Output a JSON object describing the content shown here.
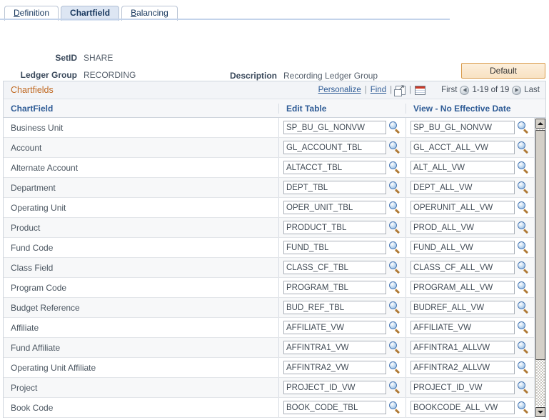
{
  "tabs": [
    {
      "label": "Definition",
      "accel": "D",
      "active": false,
      "name": "tab-definition"
    },
    {
      "label": "Chartfield",
      "accel": "",
      "active": true,
      "name": "tab-chartfield"
    },
    {
      "label": "Balancing",
      "accel": "B",
      "active": false,
      "name": "tab-balancing"
    }
  ],
  "header": {
    "setid_label": "SetID",
    "setid_value": "SHARE",
    "ledger_group_label": "Ledger Group",
    "ledger_group_value": "RECORDING",
    "description_label": "Description",
    "description_value": "Recording Ledger Group",
    "default_button": "Default"
  },
  "grid": {
    "title": "Chartfields",
    "personalize_link": "Personalize",
    "find_link": "Find",
    "sep1": "|",
    "sep2": "|",
    "sep3": "|",
    "expand_icon": "expand-window-icon",
    "spreadsheet_icon": "download-spreadsheet-icon",
    "first_label": "First",
    "last_label": "Last",
    "range_label": "1-19 of 19",
    "prev_icon": "previous-page-arrow-icon",
    "next_icon": "next-page-arrow-icon",
    "columns": {
      "chartfield": "ChartField",
      "edit_table": "Edit Table",
      "view_no_effective_date": "View - No Effective Date"
    },
    "lookup_icon": "lookup-magnifier-icon",
    "rows": [
      {
        "chartfield": "Business Unit",
        "edit_table": "SP_BU_GL_NONVW",
        "view": "SP_BU_GL_NONVW"
      },
      {
        "chartfield": "Account",
        "edit_table": "GL_ACCOUNT_TBL",
        "view": "GL_ACCT_ALL_VW"
      },
      {
        "chartfield": "Alternate Account",
        "edit_table": "ALTACCT_TBL",
        "view": "ALT_ALL_VW"
      },
      {
        "chartfield": "Department",
        "edit_table": "DEPT_TBL",
        "view": "DEPT_ALL_VW"
      },
      {
        "chartfield": "Operating Unit",
        "edit_table": "OPER_UNIT_TBL",
        "view": "OPERUNIT_ALL_VW"
      },
      {
        "chartfield": "Product",
        "edit_table": "PRODUCT_TBL",
        "view": "PROD_ALL_VW"
      },
      {
        "chartfield": "Fund Code",
        "edit_table": "FUND_TBL",
        "view": "FUND_ALL_VW"
      },
      {
        "chartfield": "Class Field",
        "edit_table": "CLASS_CF_TBL",
        "view": "CLASS_CF_ALL_VW"
      },
      {
        "chartfield": "Program Code",
        "edit_table": "PROGRAM_TBL",
        "view": "PROGRAM_ALL_VW"
      },
      {
        "chartfield": "Budget Reference",
        "edit_table": "BUD_REF_TBL",
        "view": "BUDREF_ALL_VW"
      },
      {
        "chartfield": "Affiliate",
        "edit_table": "AFFILIATE_VW",
        "view": "AFFILIATE_VW"
      },
      {
        "chartfield": "Fund Affiliate",
        "edit_table": "AFFINTRA1_VW",
        "view": "AFFINTRA1_ALLVW"
      },
      {
        "chartfield": "Operating Unit Affiliate",
        "edit_table": "AFFINTRA2_VW",
        "view": "AFFINTRA2_ALLVW"
      },
      {
        "chartfield": "Project",
        "edit_table": "PROJECT_ID_VW",
        "view": "PROJECT_ID_VW"
      },
      {
        "chartfield": "Book Code",
        "edit_table": "BOOK_CODE_TBL",
        "view": "BOOKCODE_ALL_VW"
      }
    ]
  },
  "colors": {
    "grid_title": "#c06820",
    "column_header": "#2f5c96",
    "link": "#2f5c96",
    "default_button_border": "#d89a4a",
    "tab_active_bg": "#dde6f3"
  }
}
